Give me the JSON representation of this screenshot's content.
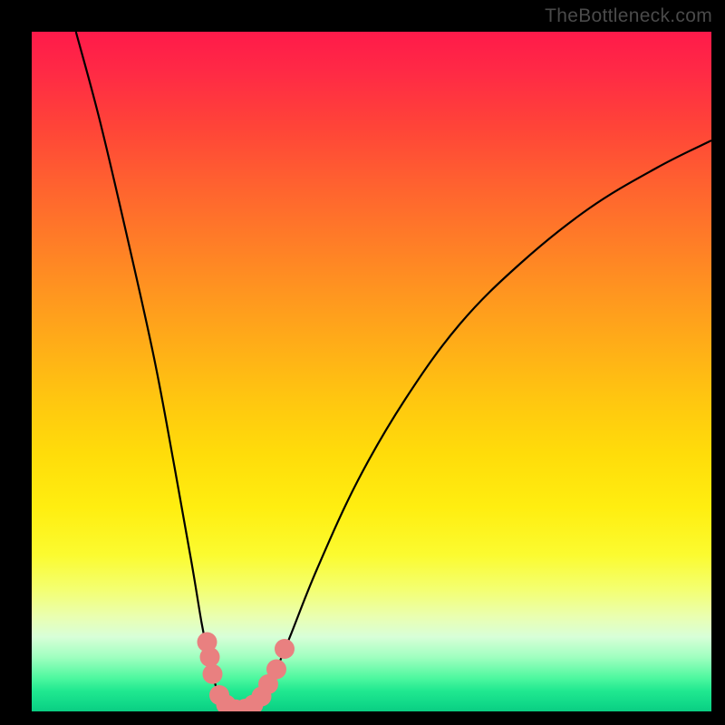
{
  "watermark": "TheBottleneck.com",
  "chart_data": {
    "type": "line",
    "title": "",
    "xlabel": "",
    "ylabel": "",
    "xlim": [
      0,
      100
    ],
    "ylim": [
      0,
      100
    ],
    "curve": [
      {
        "x": 6.5,
        "y": 100
      },
      {
        "x": 10,
        "y": 87
      },
      {
        "x": 14,
        "y": 70
      },
      {
        "x": 18,
        "y": 52
      },
      {
        "x": 21,
        "y": 36
      },
      {
        "x": 23.5,
        "y": 22
      },
      {
        "x": 25,
        "y": 13
      },
      {
        "x": 26,
        "y": 8
      },
      {
        "x": 27,
        "y": 4
      },
      {
        "x": 28,
        "y": 1.5
      },
      {
        "x": 29.5,
        "y": 0
      },
      {
        "x": 31,
        "y": 0
      },
      {
        "x": 32.5,
        "y": 0.5
      },
      {
        "x": 34,
        "y": 2
      },
      {
        "x": 35.5,
        "y": 5
      },
      {
        "x": 38,
        "y": 11
      },
      {
        "x": 42,
        "y": 21
      },
      {
        "x": 48,
        "y": 34
      },
      {
        "x": 55,
        "y": 46
      },
      {
        "x": 63,
        "y": 57
      },
      {
        "x": 72,
        "y": 66
      },
      {
        "x": 82,
        "y": 74
      },
      {
        "x": 92,
        "y": 80
      },
      {
        "x": 100,
        "y": 84
      }
    ],
    "markers": [
      {
        "x": 25.8,
        "y": 10.2
      },
      {
        "x": 26.2,
        "y": 8.0
      },
      {
        "x": 26.6,
        "y": 5.5
      },
      {
        "x": 27.6,
        "y": 2.4
      },
      {
        "x": 28.6,
        "y": 1.0
      },
      {
        "x": 30.0,
        "y": 0.3
      },
      {
        "x": 31.4,
        "y": 0.4
      },
      {
        "x": 32.6,
        "y": 1.0
      },
      {
        "x": 33.8,
        "y": 2.2
      },
      {
        "x": 34.8,
        "y": 4.0
      },
      {
        "x": 36.0,
        "y": 6.2
      },
      {
        "x": 37.2,
        "y": 9.2
      }
    ],
    "colors": {
      "curve": "#000000",
      "marker_fill": "#e98080",
      "marker_stroke": "#e98080"
    }
  }
}
